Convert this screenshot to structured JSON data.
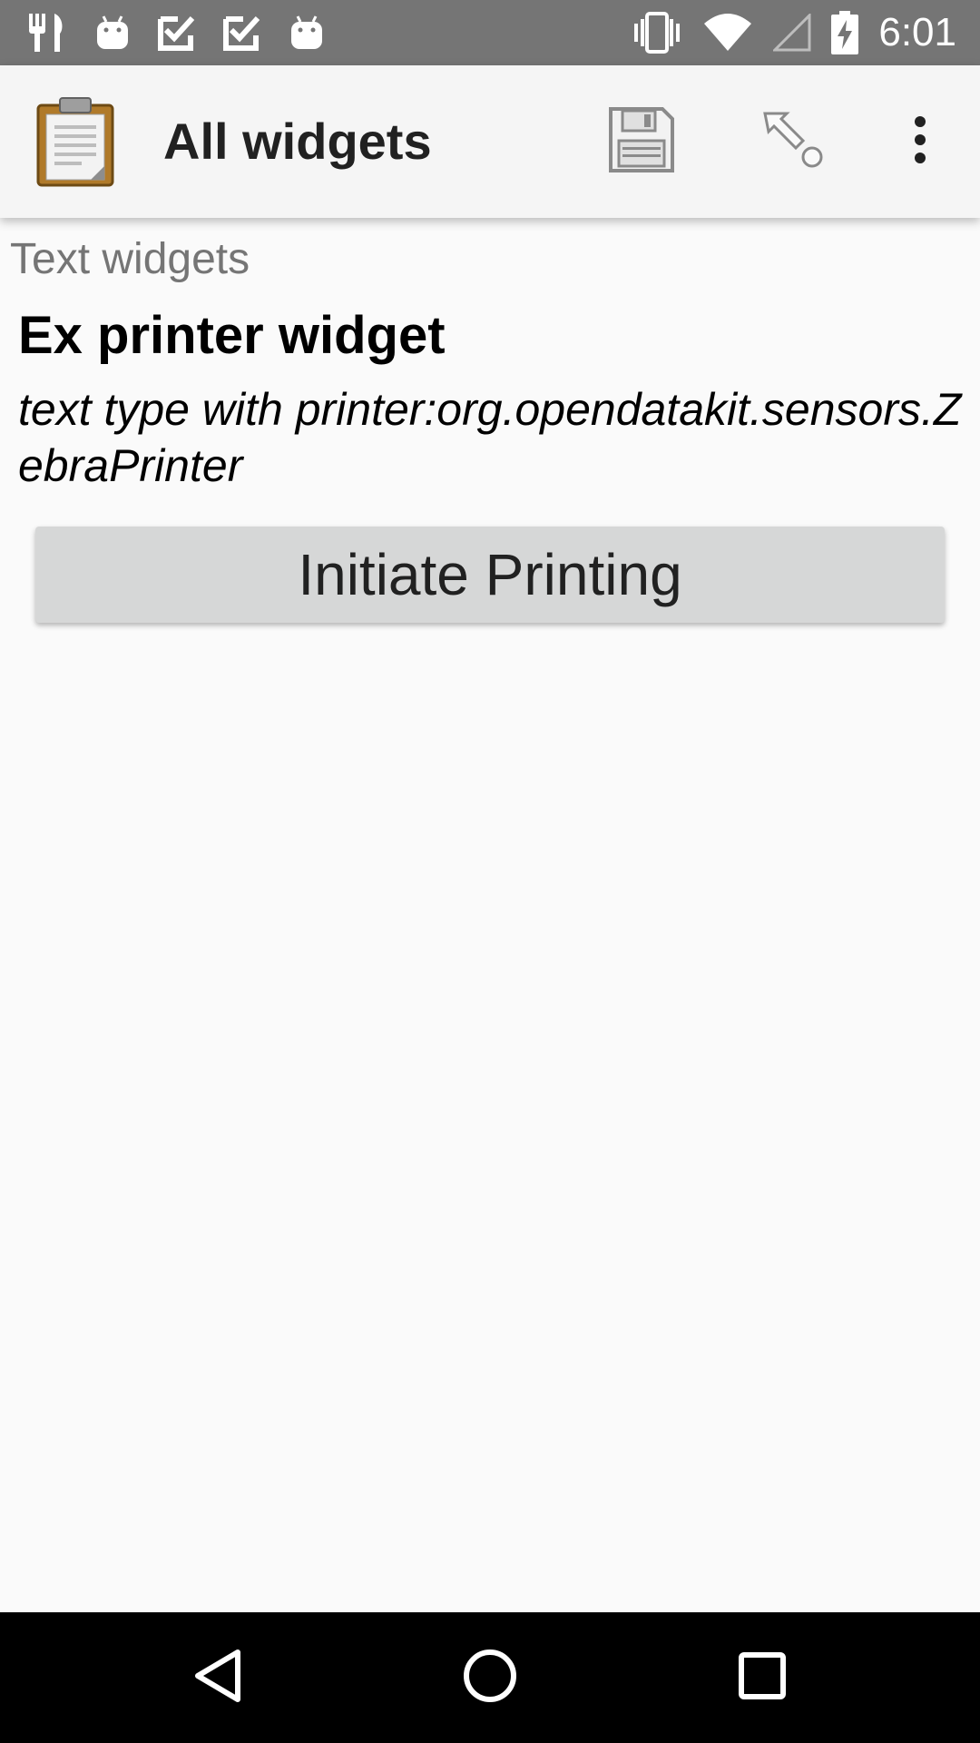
{
  "status_bar": {
    "time": "6:01",
    "left_icons": [
      "restaurant-icon",
      "android-icon",
      "check-box-icon",
      "check-box-icon",
      "android-icon"
    ],
    "right_icons": [
      "vibrate-icon",
      "wifi-icon",
      "cell-signal-icon",
      "battery-charging-icon"
    ]
  },
  "app_bar": {
    "title": "All widgets",
    "logo_icon": "clipboard-icon",
    "actions": [
      "save-icon",
      "goto-question-icon",
      "more-vert-icon"
    ]
  },
  "content": {
    "group_label": "Text widgets",
    "question_label": "Ex printer widget",
    "question_hint": "text type with printer:org.opendatakit.sensors.ZebraPrinter",
    "button_label": "Initiate Printing"
  },
  "nav_bar": {
    "buttons": [
      "back-icon",
      "home-icon",
      "recents-icon"
    ]
  },
  "colors": {
    "status_bar": "#757575",
    "app_bar": "#f5f5f5",
    "background": "#fafafa",
    "button": "#d6d7d7",
    "nav_bar": "#000000",
    "group_label": "#757575"
  }
}
